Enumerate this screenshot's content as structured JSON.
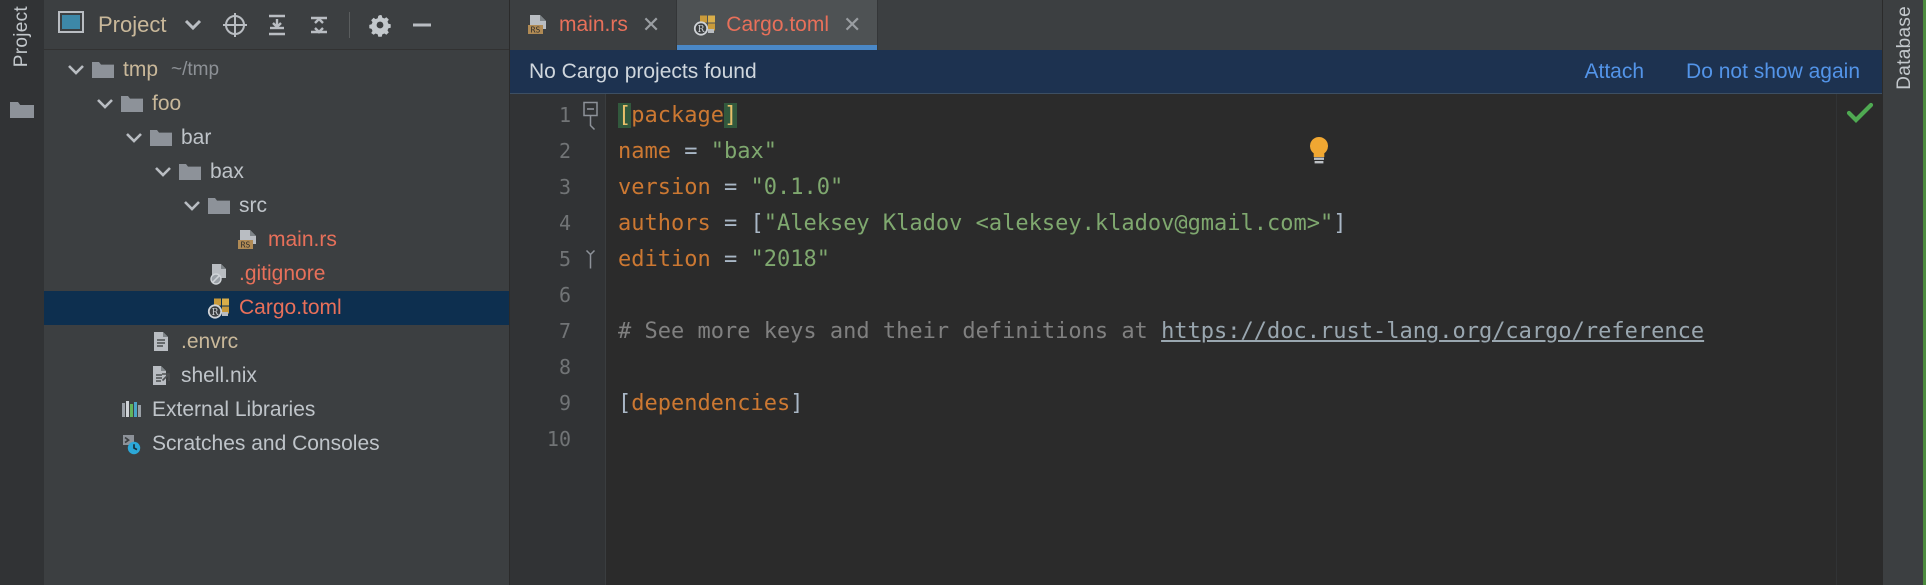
{
  "left_strip": {
    "project_tab": "Project",
    "folder_icon": "folder-icon"
  },
  "right_strip": {
    "database_tab": "Database"
  },
  "project_panel": {
    "title": "Project",
    "toolbar": [
      {
        "name": "project-view-dropdown-icon",
        "label": "chevron-down-icon"
      },
      {
        "name": "scroll-from-source-icon",
        "label": "target-icon"
      },
      {
        "name": "expand-all-icon",
        "label": "expand-all-icon"
      },
      {
        "name": "collapse-all-icon",
        "label": "collapse-all-icon"
      },
      {
        "name": "settings-icon",
        "label": "gear-icon"
      },
      {
        "name": "hide-panel-icon",
        "label": "minimize-icon"
      }
    ],
    "tree": [
      {
        "label": "tmp",
        "sub": "~/tmp",
        "icon": "folder-icon",
        "indent": 0,
        "twisty": "expanded",
        "style": "tan",
        "selected": false
      },
      {
        "label": "foo",
        "sub": "",
        "icon": "folder-icon",
        "indent": 1,
        "twisty": "expanded",
        "style": "tan",
        "selected": false
      },
      {
        "label": "bar",
        "sub": "",
        "icon": "folder-icon",
        "indent": 2,
        "twisty": "expanded",
        "style": "plain",
        "selected": false
      },
      {
        "label": "bax",
        "sub": "",
        "icon": "folder-icon",
        "indent": 3,
        "twisty": "expanded",
        "style": "plain",
        "selected": false
      },
      {
        "label": "src",
        "sub": "",
        "icon": "folder-icon",
        "indent": 4,
        "twisty": "expanded",
        "style": "plain",
        "selected": false
      },
      {
        "label": "main.rs",
        "sub": "",
        "icon": "rust-file-icon",
        "indent": 5,
        "twisty": "none",
        "style": "rust",
        "selected": false
      },
      {
        "label": ".gitignore",
        "sub": "",
        "icon": "gitignore-icon",
        "indent": 4,
        "twisty": "none",
        "style": "rust",
        "selected": false
      },
      {
        "label": "Cargo.toml",
        "sub": "",
        "icon": "cargo-icon",
        "indent": 4,
        "twisty": "none",
        "style": "rust",
        "selected": true
      },
      {
        "label": ".envrc",
        "sub": "",
        "icon": "text-file-icon",
        "indent": 2,
        "twisty": "none",
        "style": "tan",
        "selected": false
      },
      {
        "label": "shell.nix",
        "sub": "",
        "icon": "link-file-icon",
        "indent": 2,
        "twisty": "none",
        "style": "plain",
        "selected": false
      },
      {
        "label": "External Libraries",
        "sub": "",
        "icon": "libraries-icon",
        "indent": 1,
        "twisty": "none",
        "style": "plain",
        "selected": false
      },
      {
        "label": "Scratches and Consoles",
        "sub": "",
        "icon": "scratches-icon",
        "indent": 1,
        "twisty": "none",
        "style": "plain",
        "selected": false
      }
    ]
  },
  "editor": {
    "tabs": [
      {
        "label": "main.rs",
        "icon": "rust-file-icon",
        "active": false,
        "closable": true
      },
      {
        "label": "Cargo.toml",
        "icon": "cargo-icon",
        "active": true,
        "closable": true
      }
    ],
    "notification": {
      "message": "No Cargo projects found",
      "attach_label": "Attach",
      "dismiss_label": "Do not show again"
    },
    "line_numbers": [
      "1",
      "2",
      "3",
      "4",
      "5",
      "6",
      "7",
      "8",
      "9",
      "10"
    ],
    "lines": [
      {
        "no": "1",
        "fold": "minus",
        "segments": [
          {
            "text": "[",
            "cls": "tk-hdr"
          },
          {
            "text": "package",
            "cls": "tk-hdrtx"
          },
          {
            "text": "]",
            "cls": "tk-hdr"
          }
        ]
      },
      {
        "no": "2",
        "fold": "none",
        "segments": [
          {
            "text": "name",
            "cls": "tk-key"
          },
          {
            "text": " = ",
            "cls": "tk-op"
          },
          {
            "text": "\"bax\"",
            "cls": "tk-str"
          }
        ]
      },
      {
        "no": "3",
        "fold": "none",
        "segments": [
          {
            "text": "version",
            "cls": "tk-key"
          },
          {
            "text": " = ",
            "cls": "tk-op"
          },
          {
            "text": "\"0.1.0\"",
            "cls": "tk-str"
          }
        ]
      },
      {
        "no": "4",
        "fold": "none",
        "segments": [
          {
            "text": "authors",
            "cls": "tk-key"
          },
          {
            "text": " = ",
            "cls": "tk-op"
          },
          {
            "text": "[",
            "cls": "tk-brk"
          },
          {
            "text": "\"Aleksey Kladov <aleksey.kladov@gmail.com>\"",
            "cls": "tk-str"
          },
          {
            "text": "]",
            "cls": "tk-brk"
          }
        ]
      },
      {
        "no": "5",
        "fold": "end",
        "segments": [
          {
            "text": "edition",
            "cls": "tk-key"
          },
          {
            "text": " = ",
            "cls": "tk-op"
          },
          {
            "text": "\"2018\"",
            "cls": "tk-str"
          }
        ]
      },
      {
        "no": "6",
        "fold": "none",
        "segments": []
      },
      {
        "no": "7",
        "fold": "none",
        "segments": [
          {
            "text": "# See more keys and their definitions at ",
            "cls": "tk-cmt"
          },
          {
            "text": "https://doc.rust-lang.org/cargo/reference",
            "cls": "tk-url"
          }
        ]
      },
      {
        "no": "8",
        "fold": "none",
        "segments": []
      },
      {
        "no": "9",
        "fold": "none",
        "segments": [
          {
            "text": "[",
            "cls": "tk-brk"
          },
          {
            "text": "dependencies",
            "cls": "tk-key"
          },
          {
            "text": "]",
            "cls": "tk-brk"
          }
        ]
      },
      {
        "no": "10",
        "fold": "none",
        "segments": []
      }
    ],
    "intention_bulb": "lightbulb-icon",
    "inspection_status": "ok-check-icon"
  },
  "colors": {
    "accent_blue": "#4a88c7",
    "link_blue": "#5394e8",
    "notif_bg": "#1d3250",
    "selection_bg": "#0d2f4f",
    "rust_text": "#e8705a",
    "key_orange": "#cc7832",
    "string_green": "#7fa86f",
    "comment_gray": "#808080",
    "bulb_amber": "#f0a732",
    "check_green": "#4faa52",
    "panel_bg": "#3c3f41",
    "editor_bg": "#2b2b2b"
  }
}
